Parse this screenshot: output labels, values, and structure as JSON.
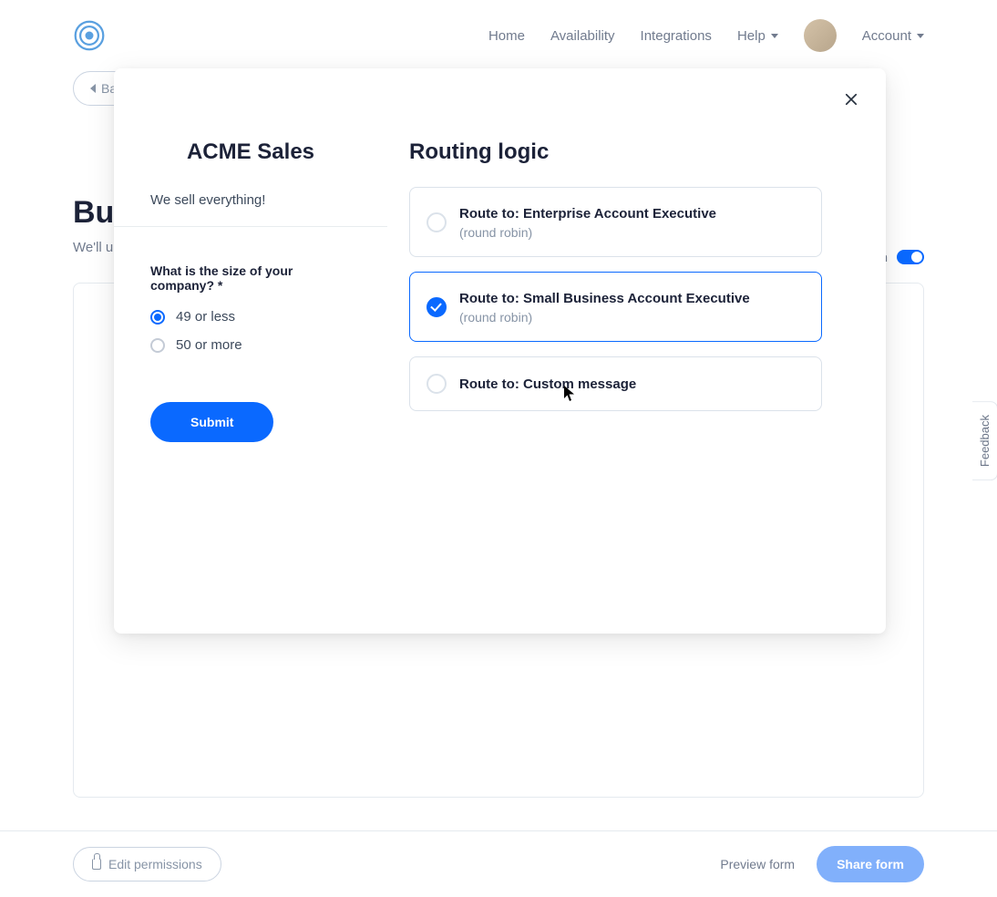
{
  "nav": {
    "items": [
      "Home",
      "Availability",
      "Integrations",
      "Help",
      "Account"
    ]
  },
  "page": {
    "back_label": "Ba",
    "title": "Buil",
    "subtitle": "We'll u",
    "toggle_partial": "n"
  },
  "footer": {
    "edit_permissions": "Edit permissions",
    "preview": "Preview form",
    "share": "Share form"
  },
  "feedback": "Feedback",
  "modal": {
    "form_name": "ACME Sales",
    "form_desc": "We sell everything!",
    "question_label": "What is the size of your company? *",
    "options": [
      {
        "label": "49 or less",
        "selected": true
      },
      {
        "label": "50 or more",
        "selected": false
      }
    ],
    "submit": "Submit",
    "routing_title": "Routing logic",
    "routes": [
      {
        "title": "Route to: Enterprise Account Executive",
        "sub": "(round robin)",
        "selected": false
      },
      {
        "title": "Route to: Small Business Account Executive",
        "sub": "(round robin)",
        "selected": true
      },
      {
        "title": "Route to: Custom message",
        "sub": "",
        "selected": false
      }
    ]
  }
}
